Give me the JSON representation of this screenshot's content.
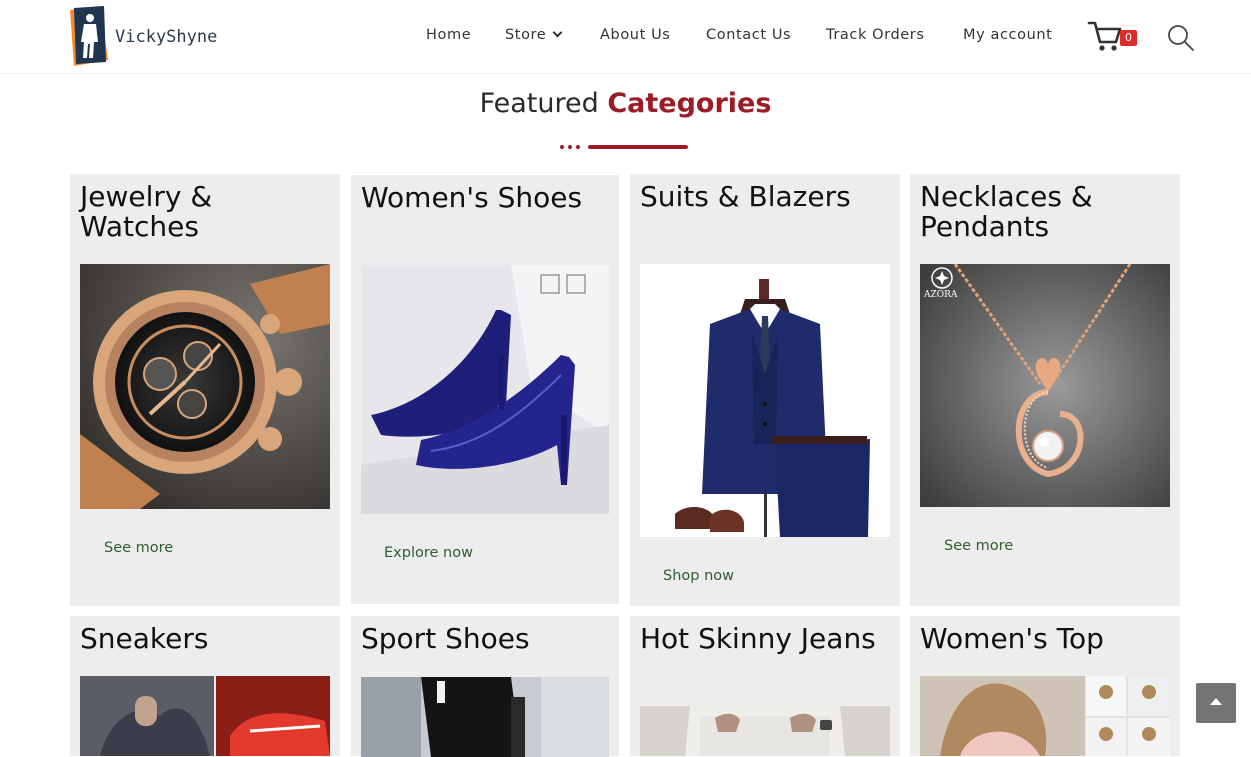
{
  "brand": {
    "name": "VickyShyne"
  },
  "nav": {
    "items": [
      {
        "label": "Home"
      },
      {
        "label": "Store"
      },
      {
        "label": "About Us"
      },
      {
        "label": "Contact Us"
      },
      {
        "label": "Track Orders"
      },
      {
        "label": "My account"
      }
    ],
    "cart_count": "0",
    "icons": {
      "cart": "cart-icon",
      "search": "search-icon",
      "dropdown": "chevron-down-icon"
    }
  },
  "section": {
    "title_plain": "Featured",
    "title_accent": "Categories"
  },
  "colors": {
    "accent": "#9b1c24",
    "card_bg": "#ededed",
    "link": "#2e5e2e",
    "badge": "#e02b2b"
  },
  "categories": [
    {
      "title": "Jewelry & Watches",
      "link": "See more"
    },
    {
      "title": "Women's Shoes",
      "link": "Explore now"
    },
    {
      "title": "Suits & Blazers",
      "link": "Shop now"
    },
    {
      "title": "Necklaces & Pendants",
      "link": "See more",
      "image_text": "AZORA"
    },
    {
      "title": "Sneakers"
    },
    {
      "title": "Sport Shoes"
    },
    {
      "title": "Hot Skinny Jeans"
    },
    {
      "title": "Women's Top"
    }
  ]
}
